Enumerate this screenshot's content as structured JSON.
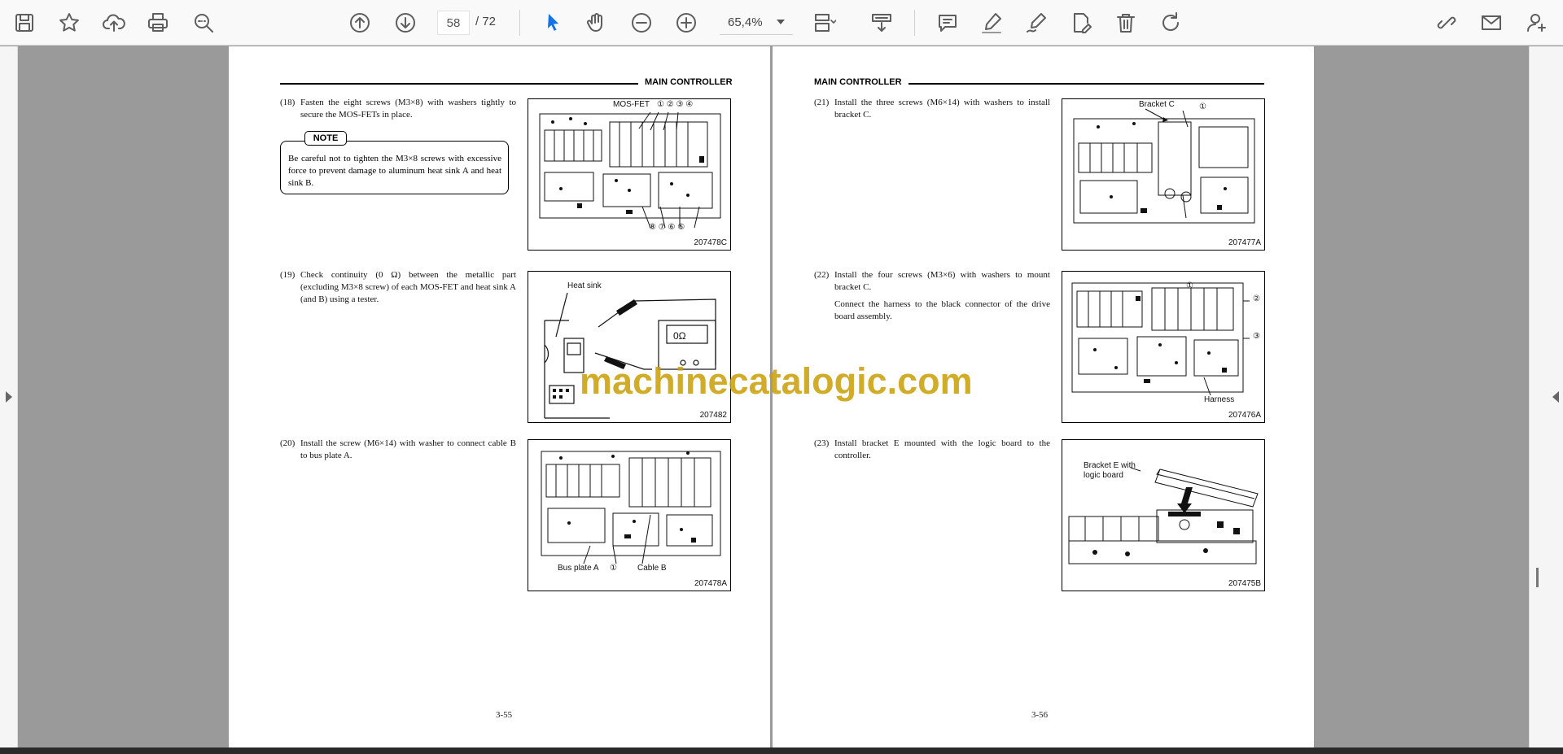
{
  "toolbar": {
    "current_page": "58",
    "total_pages": "/ 72",
    "zoom": "65,4%",
    "icons": [
      "save-icon",
      "star-icon",
      "upload-icon",
      "print-icon",
      "zoom-search-icon",
      "page-up-icon",
      "page-down-icon",
      "select-cursor-icon",
      "hand-icon",
      "zoom-out-icon",
      "zoom-in-icon",
      "fit-page-icon",
      "scroll-mode-icon",
      "comment-icon",
      "highlight-icon",
      "sign-icon",
      "edit-text-icon",
      "delete-icon",
      "rotate-icon",
      "share-link-icon",
      "email-icon",
      "add-user-icon"
    ]
  },
  "left_page": {
    "header": "MAIN CONTROLLER",
    "page_number": "3-55",
    "steps": [
      {
        "num": "(18)",
        "text": "Fasten the eight screws (M3×8) with washers tightly to secure the MOS-FETs in place.",
        "figure": "207478C",
        "labels": [
          "MOS-FET",
          "① ② ③ ④",
          "⑧ ⑦ ⑥ ⑤"
        ]
      },
      {
        "num": "(19)",
        "text": "Check continuity (0 Ω) between the metallic part (excluding M3×8 screw) of each MOS-FET and heat sink A (and B) using a tester.",
        "figure": "207482",
        "labels": [
          "Heat sink",
          "0Ω"
        ]
      },
      {
        "num": "(20)",
        "text": "Install the screw (M6×14) with washer to connect cable B to bus plate A.",
        "figure": "207478A",
        "labels": [
          "Bus plate A",
          "①",
          "Cable B"
        ]
      }
    ],
    "note": {
      "label": "NOTE",
      "text": "Be careful not to tighten the M3×8 screws with excessive force to prevent damage to aluminum heat sink A and heat sink B."
    }
  },
  "right_page": {
    "header": "MAIN CONTROLLER",
    "page_number": "3-56",
    "steps": [
      {
        "num": "(21)",
        "text": "Install the three screws (M6×14) with washers to install bracket C.",
        "figure": "207477A",
        "labels": [
          "Bracket C",
          "①"
        ]
      },
      {
        "num": "(22)",
        "text": "Install the four screws (M3×6) with washers to mount bracket C.",
        "extra": "Connect the harness to the black connector of the drive board assembly.",
        "figure": "207476A",
        "labels": [
          "①",
          "②",
          "③",
          "Harness"
        ]
      },
      {
        "num": "(23)",
        "text": "Install bracket E mounted with the logic board to the controller.",
        "figure": "207475B",
        "labels": [
          "Bracket E with",
          "logic board"
        ]
      }
    ]
  },
  "watermark": "machinecatalogic.com"
}
